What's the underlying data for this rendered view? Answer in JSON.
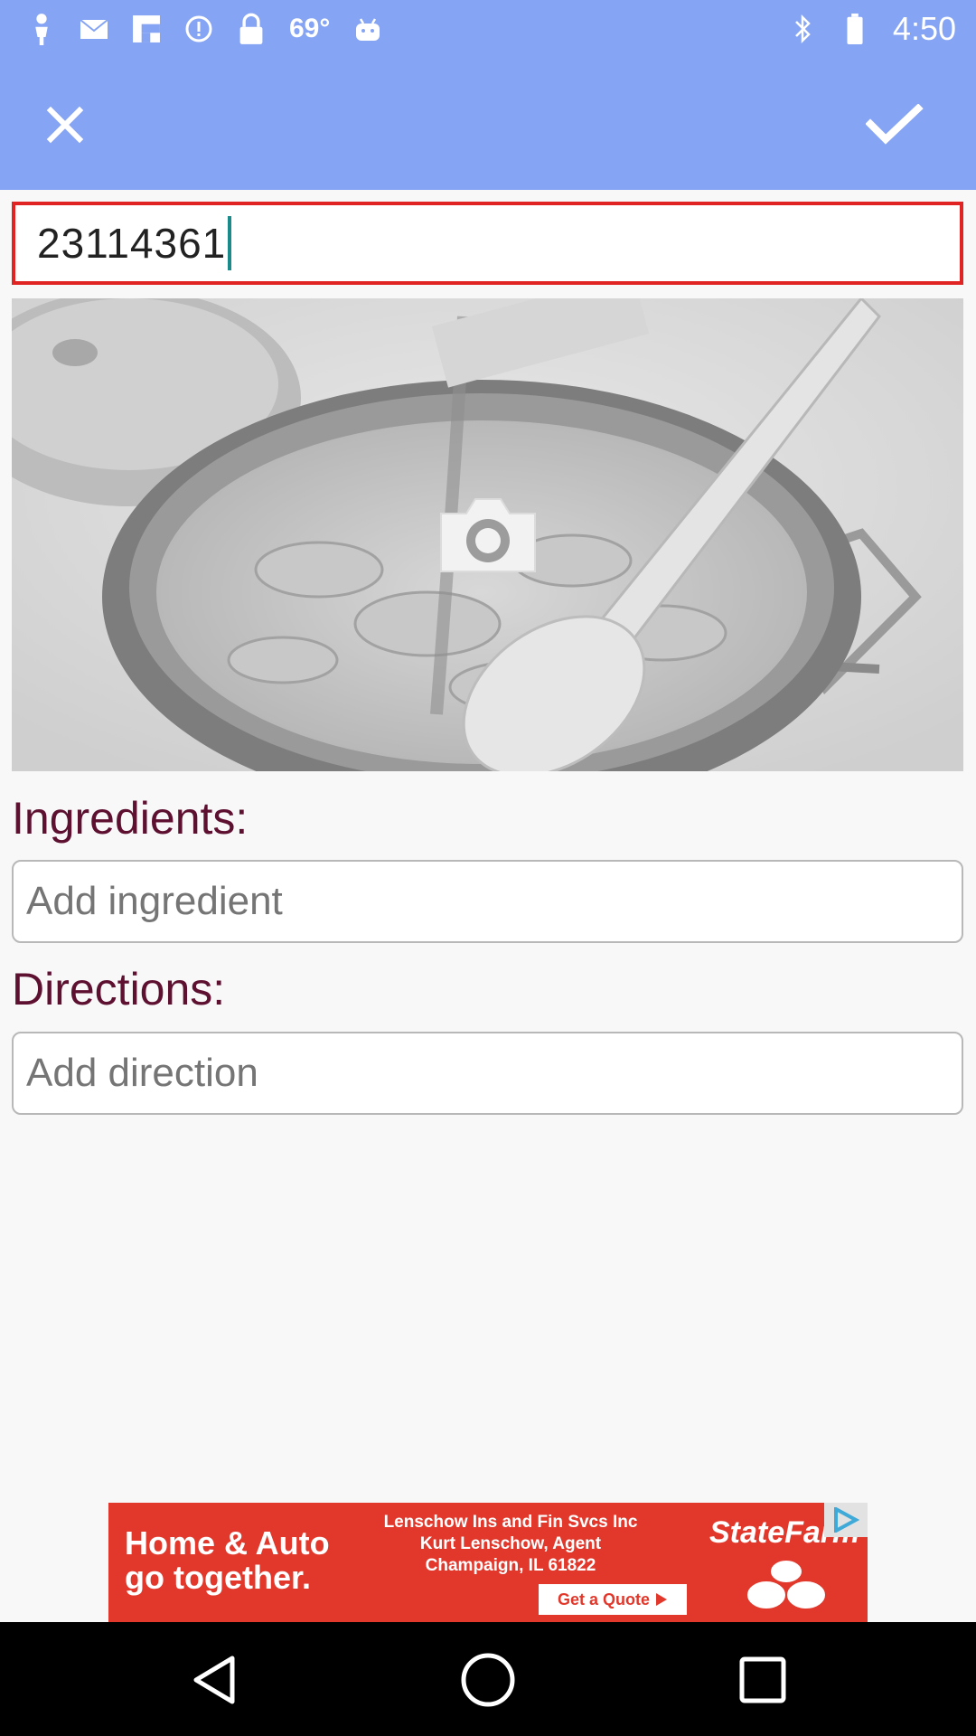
{
  "status_bar": {
    "temperature": "69°",
    "time": "4:50",
    "icons": [
      "person-icon",
      "mail-icon",
      "flipboard-icon",
      "alert-icon",
      "lock-icon",
      "android-icon",
      "bluetooth-icon"
    ]
  },
  "app_bar": {
    "close_icon": "close-icon",
    "confirm_icon": "checkmark-icon"
  },
  "recipe": {
    "title_value": "23114361"
  },
  "photo": {
    "camera_icon": "camera-icon"
  },
  "ingredients": {
    "label": "Ingredients:",
    "placeholder": "Add ingredient"
  },
  "directions": {
    "label": "Directions:",
    "placeholder": "Add direction"
  },
  "ad": {
    "headline_line1": "Home & Auto",
    "headline_line2": "go together.",
    "agent_line1": "Lenschow Ins and Fin Svcs Inc",
    "agent_line2": "Kurt Lenschow, Agent",
    "agent_line3": "Champaign, IL 61822",
    "cta": "Get a Quote",
    "brand": "StateFarm",
    "background_color": "#e2382c"
  },
  "nav_bar": {
    "buttons": [
      "back-icon",
      "home-icon",
      "recents-icon"
    ]
  },
  "colors": {
    "app_bar": "#85a4f4",
    "title_border": "#e02424",
    "section_label": "#5e1030",
    "caret": "#1a8a8a"
  }
}
